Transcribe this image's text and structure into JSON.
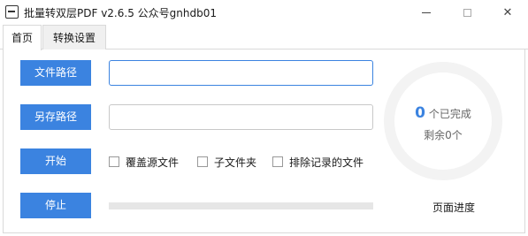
{
  "window": {
    "title": "批量转双层PDF v2.6.5 公众号gnhdb01",
    "icon": "app-icon"
  },
  "tabs": [
    {
      "label": "首页",
      "active": true
    },
    {
      "label": "转换设置",
      "active": false
    }
  ],
  "buttons": {
    "file_path": "文件路径",
    "save_path": "另存路径",
    "start": "开始",
    "stop": "停止"
  },
  "inputs": {
    "file_path_value": "",
    "save_path_value": ""
  },
  "options": [
    {
      "label": "覆盖源文件",
      "checked": false
    },
    {
      "label": "子文件夹",
      "checked": false
    },
    {
      "label": "排除记录的文件",
      "checked": false
    }
  ],
  "status": {
    "completed_count": "0",
    "completed_label": "个已完成",
    "remaining": "剩余0个",
    "page_progress_label": "页面进度",
    "page_progress_fraction": 0
  },
  "colors": {
    "accent": "#3b83e0",
    "ring": "#f3f3f3",
    "progress_track": "#e6e6e6"
  }
}
